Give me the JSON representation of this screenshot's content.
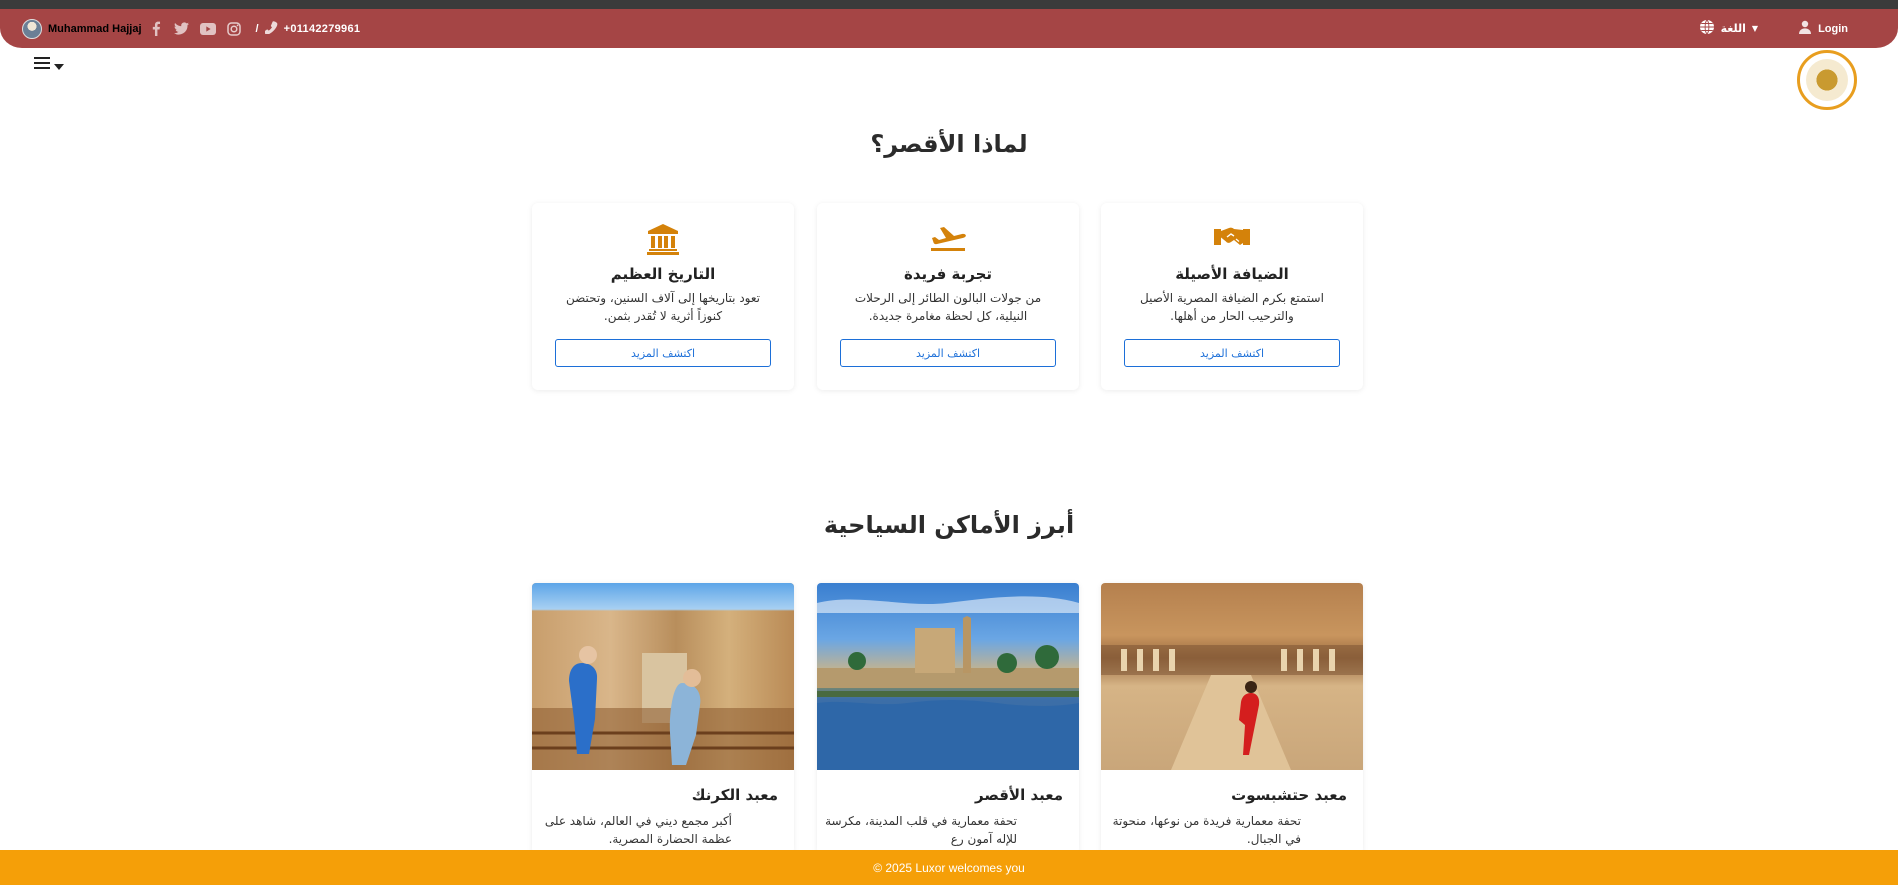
{
  "topbar": {
    "user_name": "Muhammad Hajjaj",
    "social_icons": [
      "facebook-icon",
      "twitter-icon",
      "youtube-icon",
      "instagram-icon"
    ],
    "separator": "/",
    "phone": "+01142279961",
    "language_label": "اللغة",
    "login_label": "Login",
    "background_color": "#a54545"
  },
  "why_section": {
    "title": "لماذا الأقصر؟",
    "cards": [
      {
        "icon": "handshake-icon",
        "title": "الضيافة الأصيلة",
        "description": "استمتع بكرم الضيافة المصرية الأصيل والترحيب الحار من أهلها.",
        "button": "اكتشف المزيد"
      },
      {
        "icon": "airplane-icon",
        "title": "تجربة فريدة",
        "description": "من جولات البالون الطائر إلى الرحلات النيلية، كل لحظة مغامرة جديدة.",
        "button": "اكتشف المزيد"
      },
      {
        "icon": "landmark-icon",
        "title": "التاريخ العظيم",
        "description": "تعود بتاريخها إلى آلاف السنين، وتحتضن كنوزاً أثرية لا تُقدر بثمن.",
        "button": "اكتشف المزيد"
      }
    ],
    "icon_color": "#d4820a"
  },
  "places_section": {
    "title": "أبرز الأماكن السياحية",
    "cards": [
      {
        "title": "معبد حتشبسوت",
        "description": "تحفة معمارية فريدة من نوعها، منحوتة في الجبال."
      },
      {
        "title": "معبد الأقصر",
        "description": "تحفة معمارية في قلب المدينة، مكرسة للإله آمون رع"
      },
      {
        "title": "معبد الكرنك",
        "description": "أكبر مجمع ديني في العالم، شاهد على عظمة الحضارة المصرية."
      }
    ]
  },
  "footer": {
    "text": "© 2025 Luxor welcomes you",
    "background_color": "#f59f08"
  }
}
